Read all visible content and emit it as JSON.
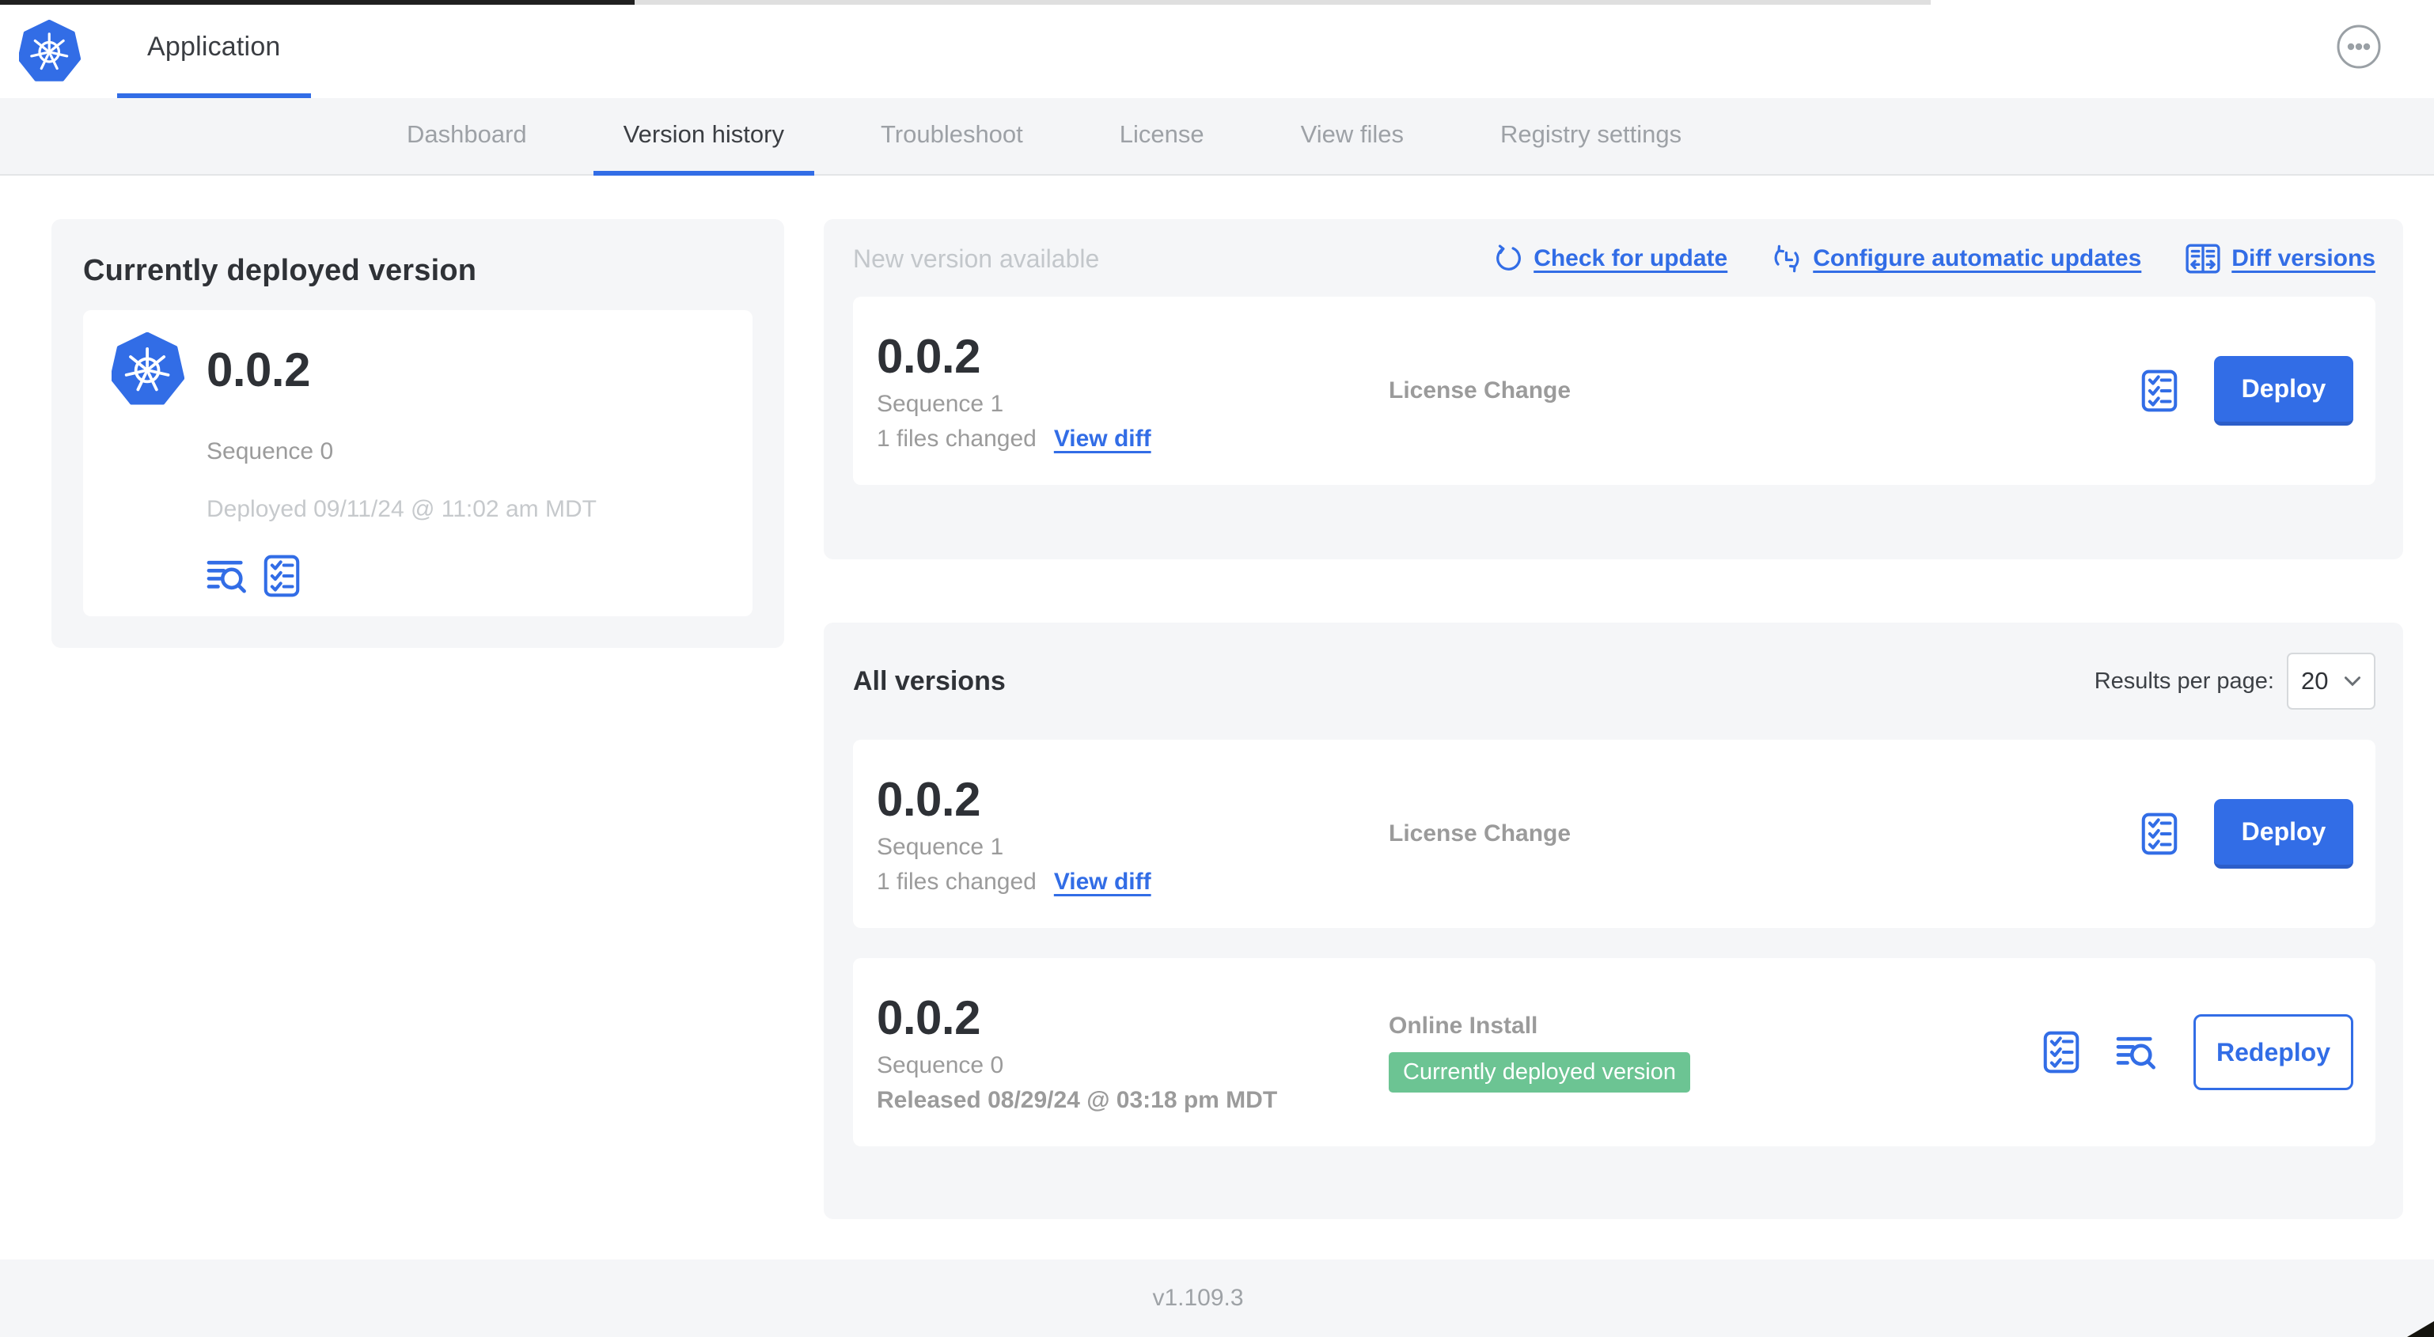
{
  "colors": {
    "accent_blue": "#326de6",
    "badge_green": "#6cc493",
    "card_bg": "#f5f6f8"
  },
  "header": {
    "app_title": "Application"
  },
  "tabs": [
    {
      "label": "Dashboard",
      "active": false
    },
    {
      "label": "Version history",
      "active": true
    },
    {
      "label": "Troubleshoot",
      "active": false
    },
    {
      "label": "License",
      "active": false
    },
    {
      "label": "View files",
      "active": false
    },
    {
      "label": "Registry settings",
      "active": false
    }
  ],
  "deployed_card": {
    "title": "Currently deployed version",
    "version": "0.0.2",
    "sequence": "Sequence 0",
    "deployed_at": "Deployed 09/11/24 @ 11:02 am MDT"
  },
  "new_version_section": {
    "title": "New version available",
    "check_for_update": "Check for update",
    "configure_auto_updates": "Configure automatic updates",
    "diff_versions": "Diff versions",
    "row": {
      "version": "0.0.2",
      "sequence": "Sequence 1",
      "files_changed": "1 files changed",
      "view_diff": "View diff",
      "status": "License Change",
      "action": "Deploy"
    }
  },
  "all_versions_section": {
    "title": "All versions",
    "results_per_page_label": "Results per page:",
    "results_per_page_value": "20",
    "rows": [
      {
        "version": "0.0.2",
        "sequence": "Sequence 1",
        "files_changed": "1 files changed",
        "view_diff": "View diff",
        "status": "License Change",
        "action": "Deploy"
      },
      {
        "version": "0.0.2",
        "sequence": "Sequence 0",
        "released": "Released 08/29/24 @ 03:18 pm MDT",
        "status": "Online Install",
        "badge": "Currently deployed version",
        "action": "Redeploy"
      }
    ]
  },
  "footer": {
    "app_version": "v1.109.3"
  }
}
